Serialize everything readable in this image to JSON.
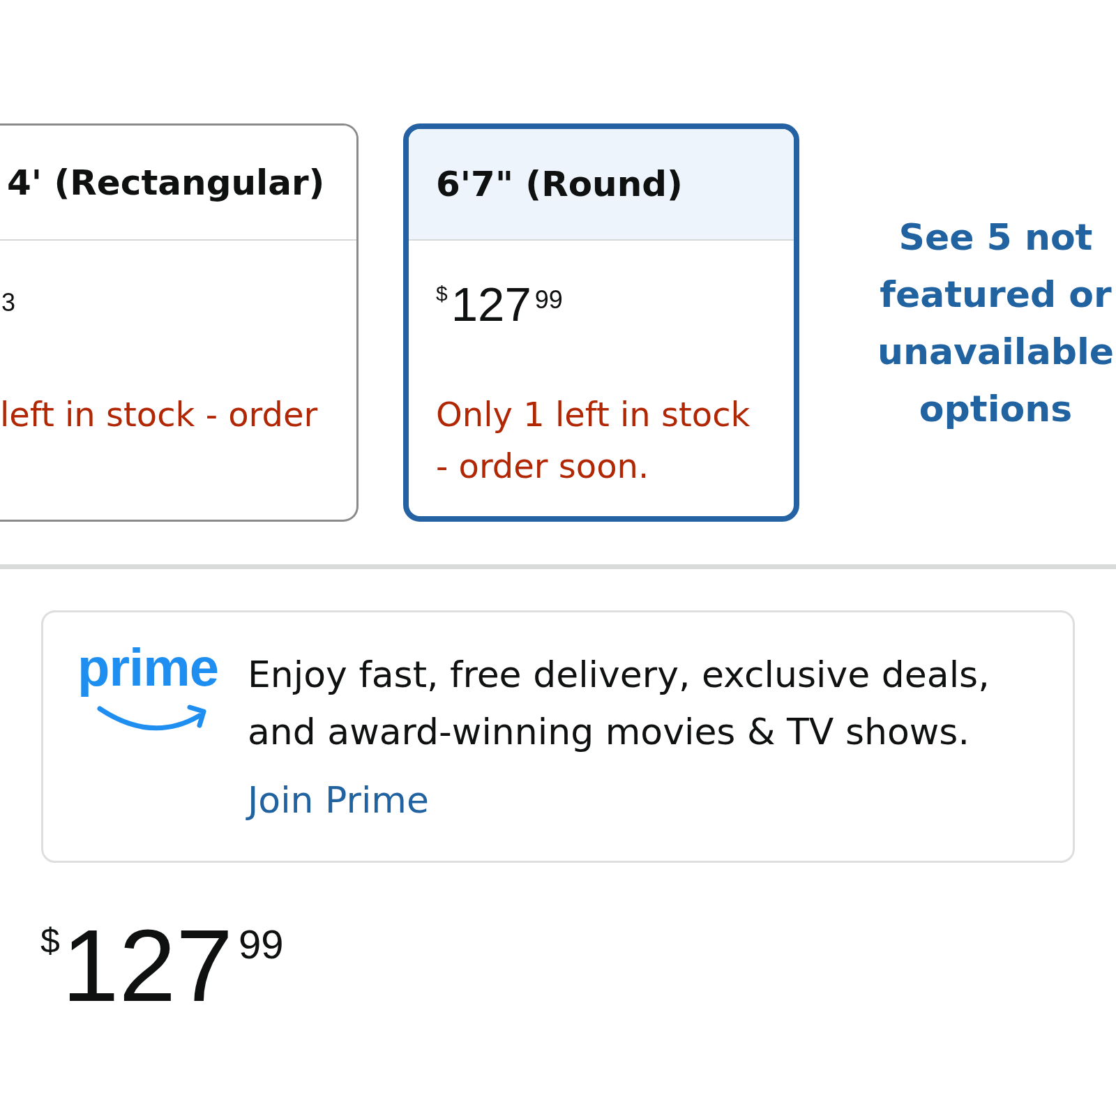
{
  "variant_options": [
    {
      "title": "4' (Rectangular)",
      "price": {
        "fraction": "3"
      },
      "stock_note": "left in stock - order",
      "selected": false
    },
    {
      "title": "6'7\" (Round)",
      "price": {
        "symbol": "$",
        "whole": "127",
        "fraction": "99"
      },
      "stock_note": "Only 1 left in stock - order soon.",
      "selected": true
    }
  ],
  "more_options_link": "See 5 not featured or unavailable options",
  "prime_banner": {
    "logo": "prime",
    "text": "Enjoy fast, free delivery, exclusive deals, and award-winning movies & TV shows.",
    "link": "Join Prime"
  },
  "price": {
    "symbol": "$",
    "whole": "127",
    "fraction": "99"
  }
}
